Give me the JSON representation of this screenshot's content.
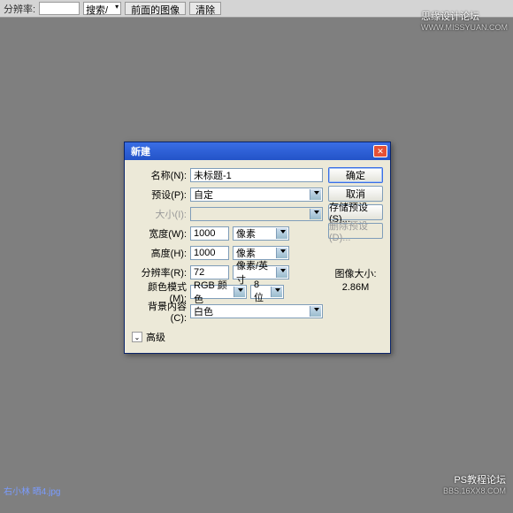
{
  "toolbar": {
    "label_resolution": "分辨率:",
    "resolution_value": "",
    "search_label": "搜索/",
    "prev_image_label": "前面的图像",
    "clear_label": "清除"
  },
  "watermarks": {
    "top_main": "思缘设计论坛",
    "top_sub": "WWW.MISSYUAN.COM",
    "br_main": "PS教程论坛",
    "br_sub": "BBS.16XX8.COM",
    "bl": "右小林 晒4.jpg"
  },
  "dialog": {
    "title": "新建",
    "fields": {
      "name_label": "名称(N):",
      "name_value": "未标题-1",
      "preset_label": "预设(P):",
      "preset_value": "自定",
      "size_label": "大小(I):",
      "width_label": "宽度(W):",
      "width_value": "1000",
      "width_unit": "像素",
      "height_label": "高度(H):",
      "height_value": "1000",
      "height_unit": "像素",
      "res_label": "分辨率(R):",
      "res_value": "72",
      "res_unit": "像素/英寸",
      "mode_label": "颜色模式(M):",
      "mode_value": "RGB 颜色",
      "bit_value": "8 位",
      "bg_label": "背景内容(C):",
      "bg_value": "白色",
      "advanced_label": "高级"
    },
    "buttons": {
      "ok": "确定",
      "cancel": "取消",
      "save_preset": "存储预设(S)...",
      "delete_preset": "删除预设(D)..."
    },
    "size_info": {
      "label": "图像大小:",
      "value": "2.86M"
    }
  }
}
